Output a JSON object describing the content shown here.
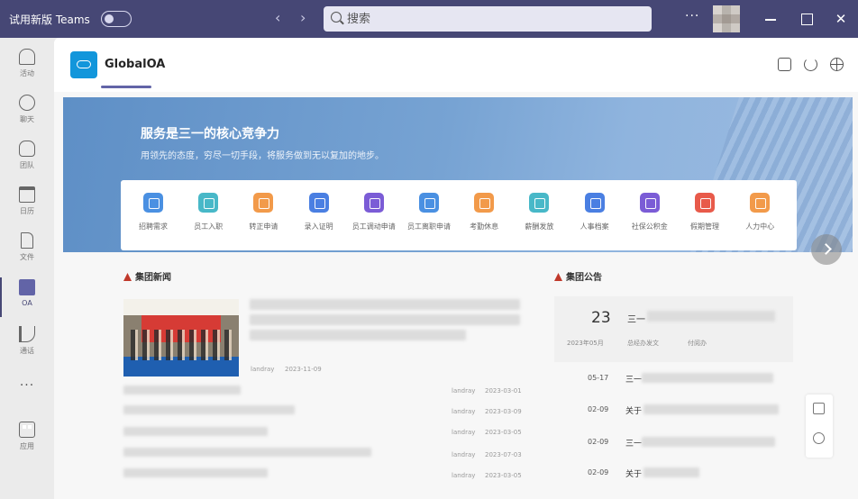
{
  "titlebar": {
    "title": "试用新版 Teams",
    "back_glyph": "‹",
    "forward_glyph": "›",
    "more_glyph": "···",
    "minimize_icon": "minimize-icon",
    "maximize_icon": "maximize-icon",
    "close_glyph": "✕"
  },
  "search": {
    "placeholder": "搜索"
  },
  "rail": {
    "items": [
      {
        "label": "活动",
        "icon": "bell-icon"
      },
      {
        "label": "聊天",
        "icon": "chat-icon"
      },
      {
        "label": "团队",
        "icon": "team-icon"
      },
      {
        "label": "日历",
        "icon": "calendar-icon"
      },
      {
        "label": "文件",
        "icon": "file-icon"
      },
      {
        "label": "OA",
        "icon": "oa-app-icon",
        "active": true
      },
      {
        "label": "通话",
        "icon": "phone-icon"
      },
      {
        "label": "···",
        "icon": "more-icon"
      },
      {
        "label": "应用",
        "icon": "apps-icon"
      }
    ]
  },
  "app": {
    "name": "GlobalOA"
  },
  "banner": {
    "title": "服务是三一的核心竞争力",
    "subtitle": "用领先的态度，穷尽一切手段，将服务做到无以复加的地步。"
  },
  "quick_links": [
    {
      "label": "招聘需求",
      "color": "#4a90e2"
    },
    {
      "label": "员工入职",
      "color": "#48b8c8"
    },
    {
      "label": "转正申请",
      "color": "#f29a4a"
    },
    {
      "label": "录入证明",
      "color": "#4a7fe2"
    },
    {
      "label": "员工调动申请",
      "color": "#7b5cd6"
    },
    {
      "label": "员工离职申请",
      "color": "#4a90e2"
    },
    {
      "label": "考勤休息",
      "color": "#f29a4a"
    },
    {
      "label": "薪酬发放",
      "color": "#48b8c8"
    },
    {
      "label": "人事档案",
      "color": "#4a7fe2"
    },
    {
      "label": "社保公积金",
      "color": "#7b5cd6"
    },
    {
      "label": "假期管理",
      "color": "#e85a4a"
    },
    {
      "label": "人力中心",
      "color": "#f29a4a"
    }
  ],
  "group_news": {
    "title": "集团新闻",
    "featured": {
      "author": "landray",
      "date": "2023-11-09"
    },
    "rows": [
      {
        "author": "landray",
        "date": "2023-03-01"
      },
      {
        "author": "landray",
        "date": "2023-03-09"
      },
      {
        "author": "landray",
        "date": "2023-03-05"
      },
      {
        "author": "landray",
        "date": "2023-07-03"
      },
      {
        "author": "landray",
        "date": "2023-03-05"
      }
    ]
  },
  "group_notice": {
    "title": "集团公告",
    "highlight": {
      "day": "23",
      "month": "2023年05月",
      "title_prefix": "三一",
      "dept": "总经办发文",
      "reads": "付阅办"
    },
    "rows": [
      {
        "date": "05-17",
        "title_prefix": "三一"
      },
      {
        "date": "02-09",
        "title_prefix": "关于"
      },
      {
        "date": "02-09",
        "title_prefix": "三一"
      },
      {
        "date": "02-09",
        "title_prefix": "关于"
      }
    ]
  }
}
